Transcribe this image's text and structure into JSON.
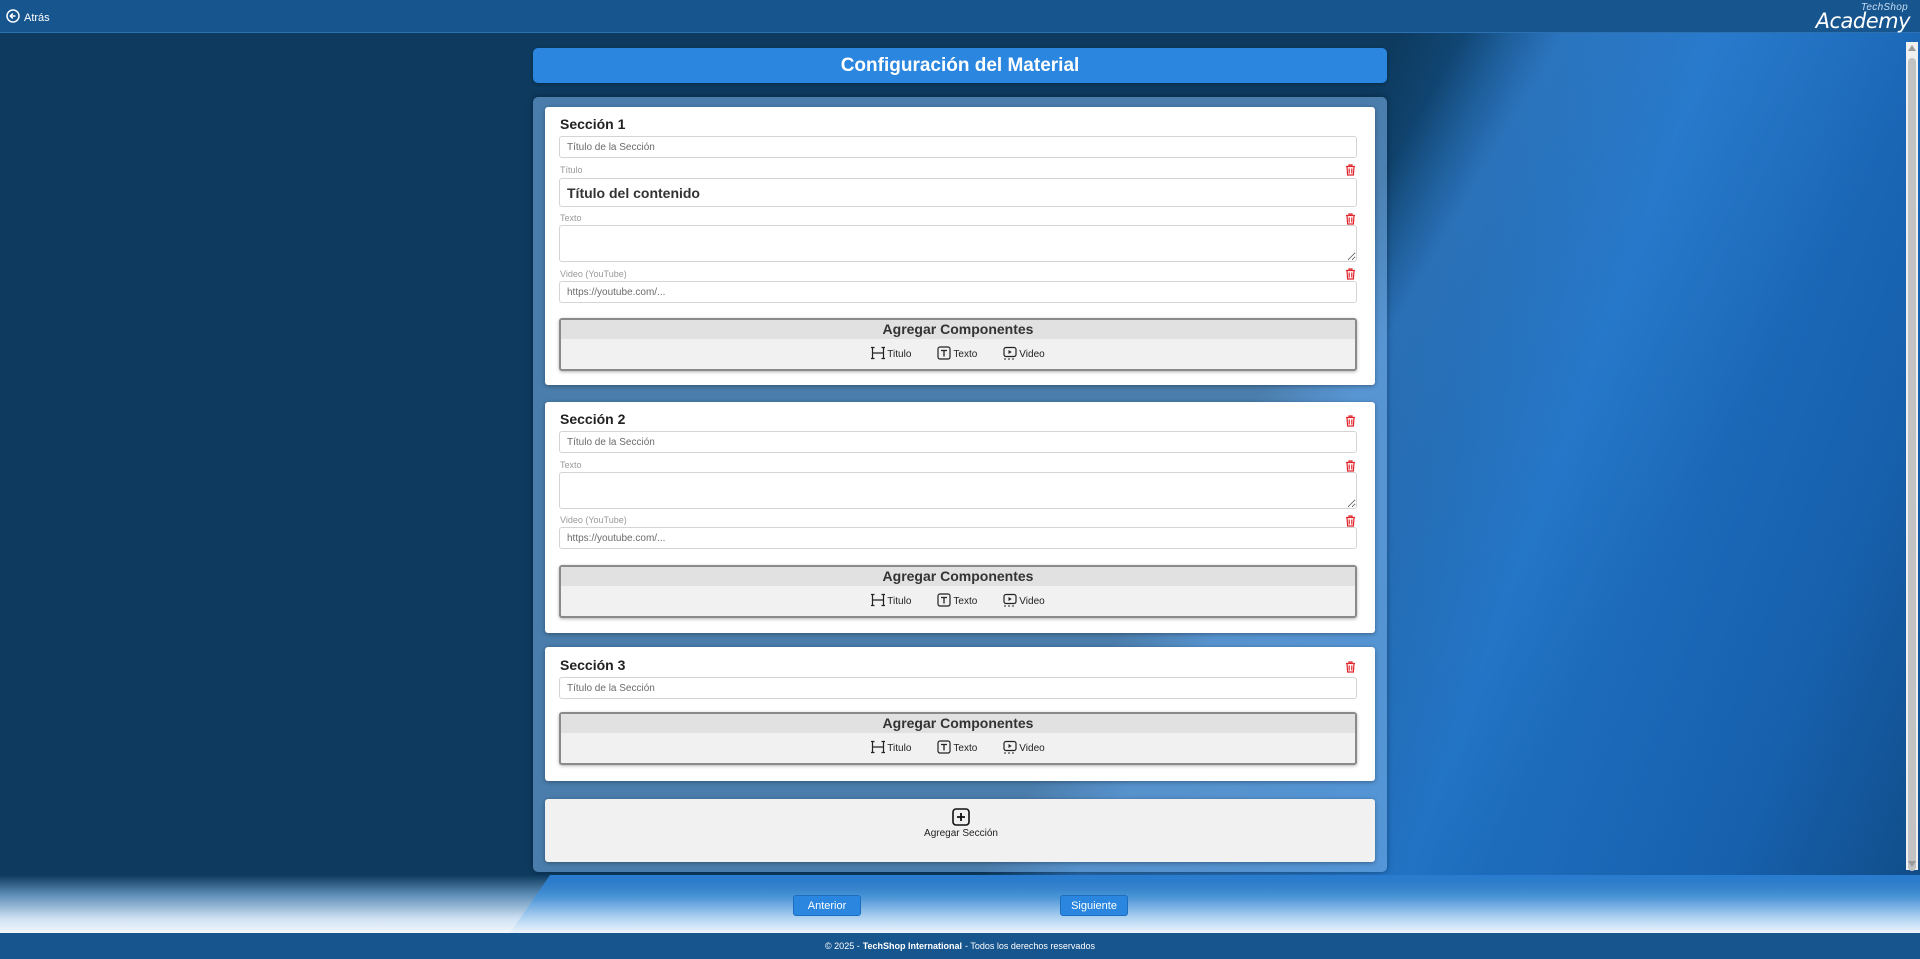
{
  "nav": {
    "back_label": "Atrás"
  },
  "logo": {
    "small": "TechShop",
    "large": "Academy"
  },
  "header": {
    "title": "Configuración del Material"
  },
  "sections": [
    {
      "title": "Sección 1",
      "title_placeholder": "Título de la Sección",
      "fields": {
        "titulo_label": "Título",
        "titulo_value": "Título del contenido",
        "texto_label": "Texto",
        "video_label": "Video (YouTube)",
        "video_placeholder": "https://youtube.com/..."
      }
    },
    {
      "title": "Sección 2",
      "title_placeholder": "Título de la Sección",
      "fields": {
        "texto_label": "Texto",
        "video_label": "Video (YouTube)",
        "video_placeholder": "https://youtube.com/..."
      }
    },
    {
      "title": "Sección 3",
      "title_placeholder": "Título de la Sección"
    }
  ],
  "components": {
    "header": "Agregar Componentes",
    "titulo": "Titulo",
    "texto": "Texto",
    "video": "Video"
  },
  "add_section": {
    "label": "Agregar Sección"
  },
  "buttons": {
    "prev": "Anterior",
    "next": "Siguiente"
  },
  "footer": {
    "copyright": "© 2025 -",
    "company": "TechShop International",
    "rights": "- Todos los derechos reservados"
  },
  "colors": {
    "accent": "#2a86de",
    "delete": "#e0252b",
    "topbar": "#17558f"
  }
}
